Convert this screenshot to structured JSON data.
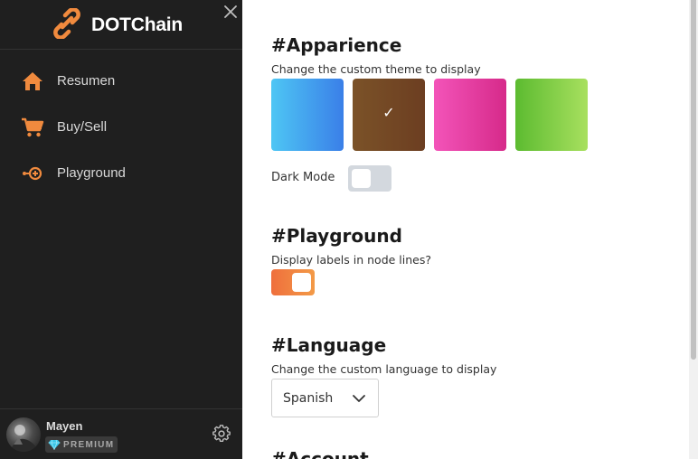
{
  "sidebar": {
    "brand": "DOTChain",
    "items": [
      {
        "label": "Resumen",
        "icon": "home-icon"
      },
      {
        "label": "Buy/Sell",
        "icon": "cart-icon"
      },
      {
        "label": "Playground",
        "icon": "node-add-icon"
      }
    ],
    "user": {
      "name": "Mayen",
      "badge": "PREMIUM"
    }
  },
  "appearance": {
    "title": "#Apparience",
    "subtitle": "Change the custom theme to display",
    "themes": [
      {
        "name": "blue",
        "colors": [
          "#4ec6f4",
          "#3a7fe8"
        ],
        "selected": false
      },
      {
        "name": "brown",
        "colors": [
          "#7b5228",
          "#6c3e21"
        ],
        "selected": true
      },
      {
        "name": "pink",
        "colors": [
          "#f354b9",
          "#d62a8a"
        ],
        "selected": false
      },
      {
        "name": "green",
        "colors": [
          "#5cbb30",
          "#a8e05f"
        ],
        "selected": false
      }
    ],
    "check_mark": "✓",
    "dark_mode_label": "Dark Mode",
    "dark_mode_on": false
  },
  "playground": {
    "title": "#Playground",
    "subtitle": "Display labels in node lines?",
    "labels_on": true
  },
  "language": {
    "title": "#Language",
    "subtitle": "Change the custom language to display",
    "selected": "Spanish"
  },
  "account": {
    "title": "#Account"
  },
  "colors": {
    "accent": "#f08a3e",
    "sidebar_bg": "#1f1f1f",
    "gem": "#39c6e8"
  }
}
